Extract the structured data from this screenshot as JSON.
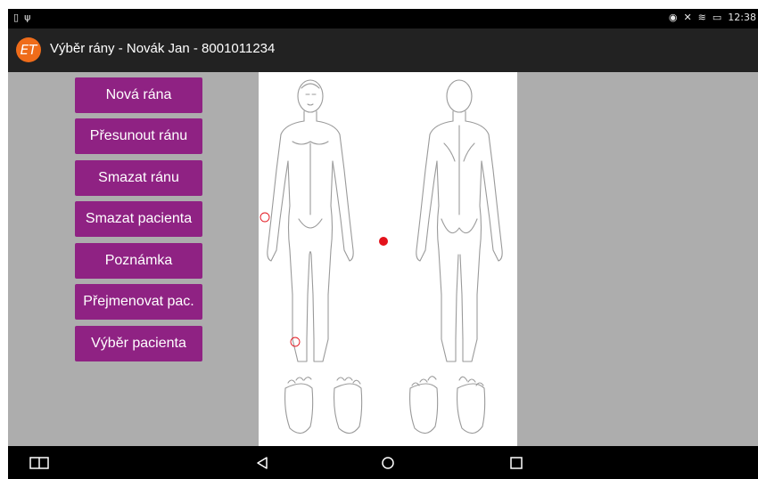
{
  "status_bar": {
    "left_icons": [
      "notification-icon",
      "usb-icon"
    ],
    "right_icons": [
      "nfc-icon",
      "mute-icon",
      "wifi-icon",
      "battery-charging-icon"
    ],
    "time": "12:38"
  },
  "app_bar": {
    "logo_text": "ET",
    "title": "Výběr rány - Novák Jan - 8001011234"
  },
  "menu": {
    "buttons": [
      {
        "label": "Nová rána"
      },
      {
        "label": "Přesunout ránu"
      },
      {
        "label": "Smazat ránu"
      },
      {
        "label": "Smazat pacienta"
      },
      {
        "label": "Poznámka"
      },
      {
        "label": "Přejmenovat pac."
      },
      {
        "label": "Výběr pacienta"
      }
    ]
  },
  "body_map": {
    "views": [
      "front",
      "back",
      "soles"
    ],
    "wound_markers": [
      {
        "label": "selected wound",
        "state": "selected",
        "color": "#e3121b"
      },
      {
        "label": "wound right hand",
        "state": "unselected",
        "color": "#e3121b"
      },
      {
        "label": "wound left lower leg",
        "state": "unselected",
        "color": "#e3121b"
      }
    ]
  },
  "nav_bar": {
    "icons": [
      "split-screen-icon",
      "back-icon",
      "home-icon",
      "recents-icon"
    ]
  },
  "colors": {
    "accent_button": "#8f2283",
    "logo": "#ef6c1a",
    "panel_background": "#adadad",
    "wound_marker": "#e3121b"
  }
}
